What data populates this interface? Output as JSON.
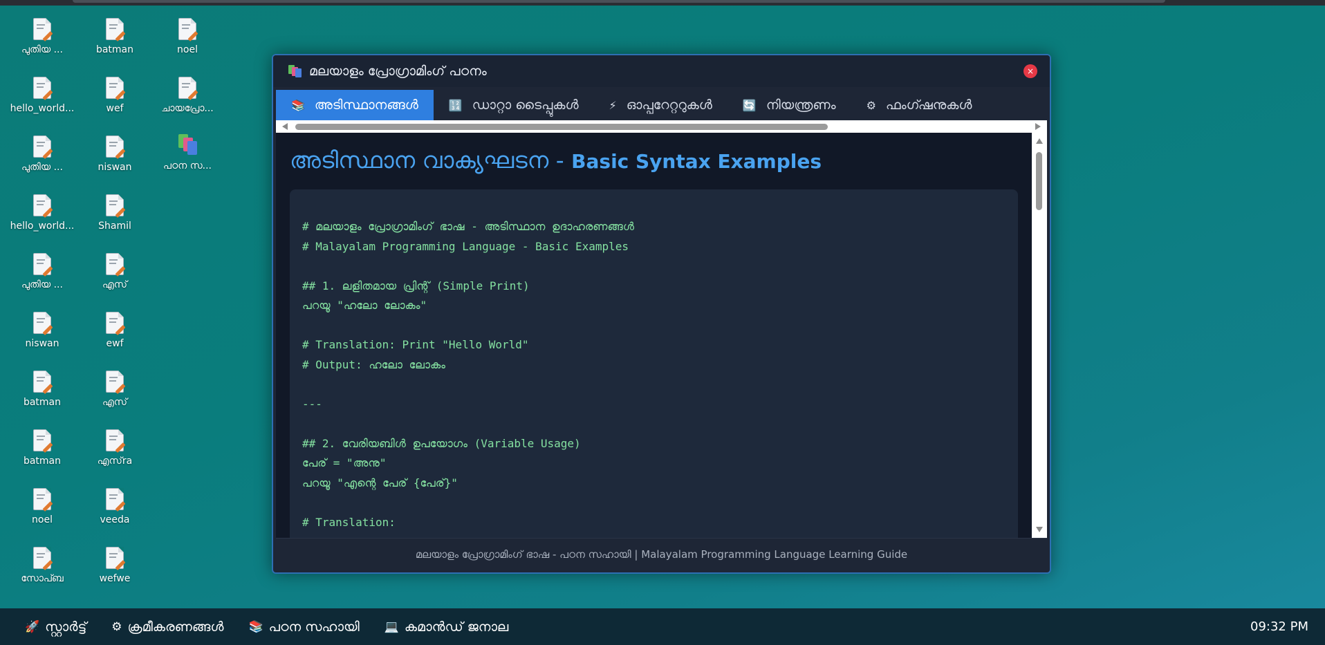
{
  "desktop": {
    "icons": [
      {
        "label": "പുതിയ ...",
        "type": "file"
      },
      {
        "label": "hello_world...",
        "type": "file"
      },
      {
        "label": "പുതിയ ...",
        "type": "file"
      },
      {
        "label": "hello_world...",
        "type": "file"
      },
      {
        "label": "പുതിയ ...",
        "type": "file"
      },
      {
        "label": "niswan",
        "type": "file"
      },
      {
        "label": "batman",
        "type": "file"
      },
      {
        "label": "batman",
        "type": "file"
      },
      {
        "label": "noel",
        "type": "file"
      },
      {
        "label": "സോപ്ബ",
        "type": "file"
      },
      {
        "label": "batman",
        "type": "file"
      },
      {
        "label": "wef",
        "type": "file"
      },
      {
        "label": "niswan",
        "type": "file"
      },
      {
        "label": "Shamil",
        "type": "file"
      },
      {
        "label": "എസ്",
        "type": "file"
      },
      {
        "label": "ewf",
        "type": "file"
      },
      {
        "label": "എസ്",
        "type": "file"
      },
      {
        "label": "എസ്ra",
        "type": "file"
      },
      {
        "label": "veeda",
        "type": "file"
      },
      {
        "label": "wefwe",
        "type": "file"
      },
      {
        "label": "noel",
        "type": "file"
      },
      {
        "label": "ചായപ്രോ...",
        "type": "file"
      },
      {
        "label": "പഠന സ...",
        "type": "app"
      }
    ]
  },
  "window": {
    "title": "മലയാളം പ്രോഗ്രാമിംഗ് പഠനം",
    "close_label": "×",
    "tabs": [
      {
        "label": "അടിസ്ഥാനങ്ങൾ",
        "icon": "books-icon",
        "glyph": "📚",
        "active": true
      },
      {
        "label": "ഡാറ്റാ ടൈപ്പുകൾ",
        "icon": "numbers-icon",
        "glyph": "🔢",
        "active": false
      },
      {
        "label": "ഓപ്പറേറ്ററുകൾ",
        "icon": "lightning-icon",
        "glyph": "⚡",
        "active": false
      },
      {
        "label": "നിയന്ത്രണം",
        "icon": "loop-icon",
        "glyph": "🔄",
        "active": false
      },
      {
        "label": "ഫംഗ്ഷനുകൾ",
        "icon": "gear-icon",
        "glyph": "⚙",
        "active": false
      }
    ],
    "content": {
      "title_ml": "അടിസ്ഥാന വാക്യഘടന - ",
      "title_en": "Basic Syntax Examples",
      "code_lines": [
        "# മലയാളം പ്രോഗ്രാമിംഗ് ഭാഷ - അടിസ്ഥാന ഉദാഹരണങ്ങൾ",
        "# Malayalam Programming Language - Basic Examples",
        "",
        "## 1. ലളിതമായ പ്രിന്റ് (Simple Print)",
        "പറയൂ \"ഹലോ ലോകം\"",
        "",
        "# Translation: Print \"Hello World\"",
        "# Output: ഹലോ ലോകം",
        "",
        "---",
        "",
        "## 2. വേരിയബിൾ ഉപയോഗം (Variable Usage)",
        "പേര് = \"അനു\"",
        "പറയൂ \"എന്റെ പേര് {പേര്}\"",
        "",
        "# Translation:"
      ]
    },
    "footer": "മലയാളം പ്രോഗ്രാമിംഗ് ഭാഷ - പഠന സഹായി | Malayalam Programming Language Learning Guide"
  },
  "taskbar": {
    "items": [
      {
        "label": "സ്റ്റാർട്ട്",
        "icon": "rocket-icon",
        "glyph": "🚀"
      },
      {
        "label": "ക്രമീകരണങ്ങൾ",
        "icon": "gear-icon",
        "glyph": "⚙"
      },
      {
        "label": "പഠന സഹായി",
        "icon": "books-icon",
        "glyph": "📚"
      },
      {
        "label": "കമാൻഡ് ജനാല",
        "icon": "monitor-icon",
        "glyph": "💻"
      }
    ],
    "clock": "09:32 PM"
  },
  "colors": {
    "desktop": "#0b7b78",
    "window_bg": "#1e2636",
    "active_tab": "#2f7fe0",
    "title_blue": "#4aa3f0",
    "code_green": "#84e0a0",
    "close_red": "#e63946",
    "taskbar": "#0e2936"
  }
}
